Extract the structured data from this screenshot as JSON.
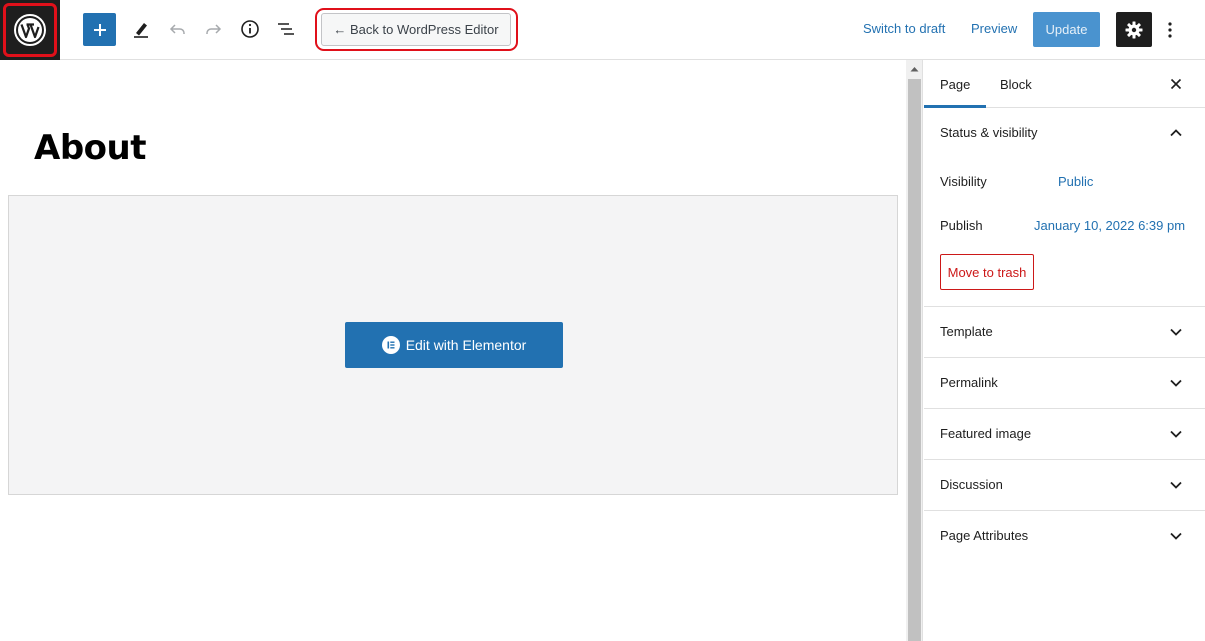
{
  "toolbar": {
    "back_label": "← Back to WordPress Editor",
    "switch_draft_label": "Switch to draft",
    "preview_label": "Preview",
    "update_label": "Update"
  },
  "editor": {
    "page_title": "About",
    "elementor_button_label": "Edit with Elementor"
  },
  "sidebar": {
    "tabs": [
      {
        "label": "Page",
        "active": true
      },
      {
        "label": "Block",
        "active": false
      }
    ],
    "status": {
      "title": "Status & visibility",
      "visibility_label": "Visibility",
      "visibility_value": "Public",
      "publish_label": "Publish",
      "publish_value": "January 10, 2022 6:39 pm",
      "trash_label": "Move to trash"
    },
    "panels": [
      {
        "label": "Template"
      },
      {
        "label": "Permalink"
      },
      {
        "label": "Featured image"
      },
      {
        "label": "Discussion"
      },
      {
        "label": "Page Attributes"
      }
    ]
  },
  "colors": {
    "accent": "#2271b1",
    "highlight": "#e0101a",
    "danger": "#cc1818",
    "dark": "#1e1e1e"
  },
  "icons": [
    "wordpress-logo-icon",
    "plus-icon",
    "pencil-icon",
    "undo-icon",
    "redo-icon",
    "info-icon",
    "list-view-icon",
    "gear-icon",
    "more-vertical-icon",
    "close-icon",
    "chevron-up-icon",
    "chevron-down-icon",
    "elementor-icon"
  ]
}
